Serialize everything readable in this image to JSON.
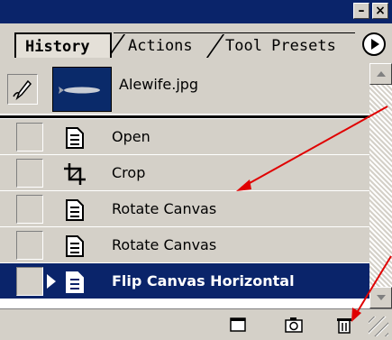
{
  "tabs": [
    {
      "label": "History",
      "active": true
    },
    {
      "label": "Actions",
      "active": false
    },
    {
      "label": "Tool Presets",
      "active": false
    }
  ],
  "snapshot": {
    "label": "Alewife.jpg"
  },
  "history": [
    {
      "label": "Open",
      "icon": "document-step-icon",
      "selected": false
    },
    {
      "label": "Crop",
      "icon": "crop-icon",
      "selected": false
    },
    {
      "label": "Rotate Canvas",
      "icon": "document-step-icon",
      "selected": false
    },
    {
      "label": "Rotate Canvas",
      "icon": "document-step-icon",
      "selected": false
    },
    {
      "label": "Flip Canvas Horizontal",
      "icon": "document-step-icon",
      "selected": true
    }
  ],
  "toolbar": [
    "new-document-from-state-icon",
    "new-snapshot-icon",
    "trash-icon"
  ],
  "colors": {
    "titlebar": "#0a246a",
    "panel": "#d4d0c8",
    "selected": "#0a246a",
    "annotation_arrow": "#e00000"
  }
}
